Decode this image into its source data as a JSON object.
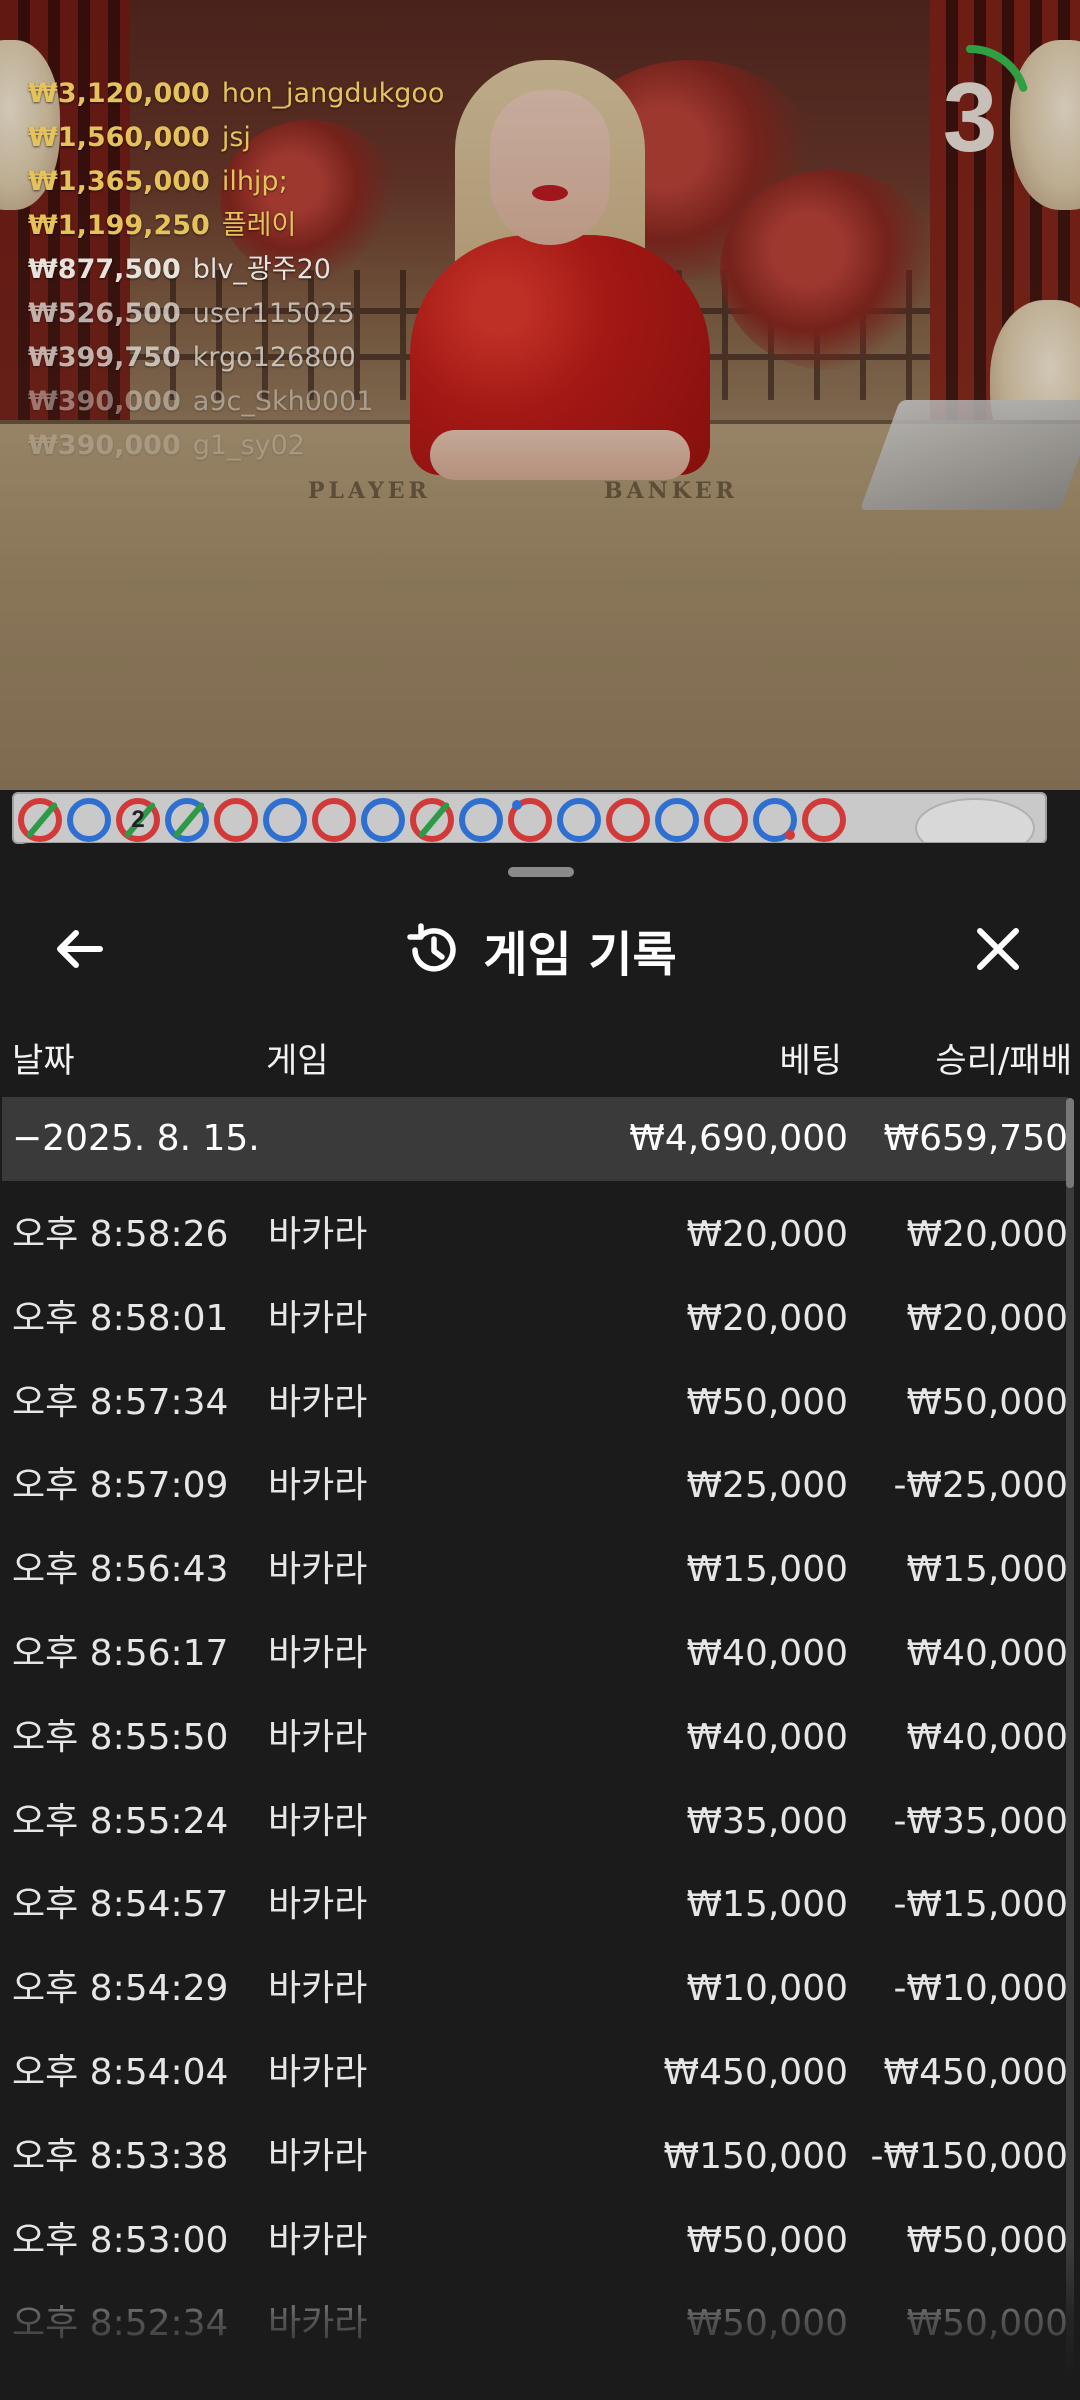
{
  "video": {
    "table_labels": {
      "player": "PLAYER",
      "banker": "BANKER"
    },
    "winners": [
      {
        "amount": "₩3,120,000",
        "name": "hon_jangdukgoo"
      },
      {
        "amount": "₩1,560,000",
        "name": "jsj"
      },
      {
        "amount": "₩1,365,000",
        "name": "ilhjp;"
      },
      {
        "amount": "₩1,199,250",
        "name": "플레이"
      },
      {
        "amount": "₩877,500",
        "name": "blv_광주20"
      },
      {
        "amount": "₩526,500",
        "name": "user115025"
      },
      {
        "amount": "₩399,750",
        "name": "krgo126800"
      },
      {
        "amount": "₩390,000",
        "name": "a9c_Skh0001"
      },
      {
        "amount": "₩390,000",
        "name": "g1_sy02"
      }
    ],
    "countdown": {
      "value": "3",
      "remaining_fraction": 0.2,
      "color": "#2ea043"
    }
  },
  "bead_road": {
    "beads": [
      {
        "color": "red",
        "marker": "green-slash"
      },
      {
        "color": "blue",
        "marker": "none"
      },
      {
        "color": "red",
        "marker": "green-slash"
      },
      {
        "color": "blue",
        "marker": "green-slash"
      },
      {
        "color": "red",
        "marker": "none"
      },
      {
        "color": "blue",
        "marker": "none"
      },
      {
        "color": "red",
        "marker": "none"
      },
      {
        "color": "blue",
        "marker": "none"
      },
      {
        "color": "red",
        "marker": "green-slash"
      },
      {
        "color": "blue",
        "marker": "none"
      },
      {
        "color": "red",
        "marker": "blue-dot"
      },
      {
        "color": "blue",
        "marker": "none"
      },
      {
        "color": "red",
        "marker": "none"
      },
      {
        "color": "blue",
        "marker": "none"
      },
      {
        "color": "red",
        "marker": "none"
      },
      {
        "color": "blue",
        "marker": "red-dot"
      },
      {
        "color": "red",
        "marker": "none"
      }
    ],
    "number_label": "2",
    "colors": {
      "red": "#d23a3a",
      "blue": "#2f6fd0",
      "green": "#2e9a48"
    }
  },
  "history": {
    "title": "게임 기록",
    "icons": {
      "back": "arrow-left-icon",
      "title": "history-icon",
      "close": "close-icon"
    },
    "columns": {
      "date": "날짜",
      "game": "게임",
      "bet": "베팅",
      "result": "승리/패배"
    },
    "summary": {
      "date": "−2025. 8. 15.",
      "bet": "₩4,690,000",
      "result": "₩659,750"
    },
    "rows": [
      {
        "time": "오후 8:58:26",
        "game": "바카라",
        "bet": "₩20,000",
        "result": "₩20,000"
      },
      {
        "time": "오후 8:58:01",
        "game": "바카라",
        "bet": "₩20,000",
        "result": "₩20,000"
      },
      {
        "time": "오후 8:57:34",
        "game": "바카라",
        "bet": "₩50,000",
        "result": "₩50,000"
      },
      {
        "time": "오후 8:57:09",
        "game": "바카라",
        "bet": "₩25,000",
        "result": "-₩25,000"
      },
      {
        "time": "오후 8:56:43",
        "game": "바카라",
        "bet": "₩15,000",
        "result": "₩15,000"
      },
      {
        "time": "오후 8:56:17",
        "game": "바카라",
        "bet": "₩40,000",
        "result": "₩40,000"
      },
      {
        "time": "오후 8:55:50",
        "game": "바카라",
        "bet": "₩40,000",
        "result": "₩40,000"
      },
      {
        "time": "오후 8:55:24",
        "game": "바카라",
        "bet": "₩35,000",
        "result": "-₩35,000"
      },
      {
        "time": "오후 8:54:57",
        "game": "바카라",
        "bet": "₩15,000",
        "result": "-₩15,000"
      },
      {
        "time": "오후 8:54:29",
        "game": "바카라",
        "bet": "₩10,000",
        "result": "-₩10,000"
      },
      {
        "time": "오후 8:54:04",
        "game": "바카라",
        "bet": "₩450,000",
        "result": "₩450,000"
      },
      {
        "time": "오후 8:53:38",
        "game": "바카라",
        "bet": "₩150,000",
        "result": "-₩150,000"
      },
      {
        "time": "오후 8:53:00",
        "game": "바카라",
        "bet": "₩50,000",
        "result": "₩50,000"
      },
      {
        "time": "오후 8:52:34",
        "game": "바카라",
        "bet": "₩50,000",
        "result": "₩50,000"
      }
    ]
  }
}
